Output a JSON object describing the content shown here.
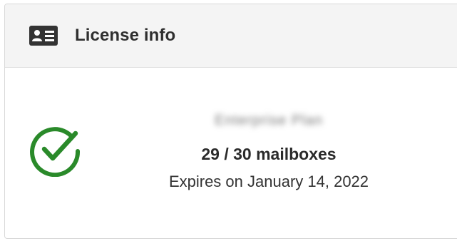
{
  "header": {
    "title": "License info",
    "icon": "id-card-icon"
  },
  "license": {
    "status_icon": "check-circle-icon",
    "status_color": "#2a8a2a",
    "name_blurred": "Enterprise Plan",
    "mailboxes": "29 / 30 mailboxes",
    "expires": "Expires on January 14, 2022"
  }
}
